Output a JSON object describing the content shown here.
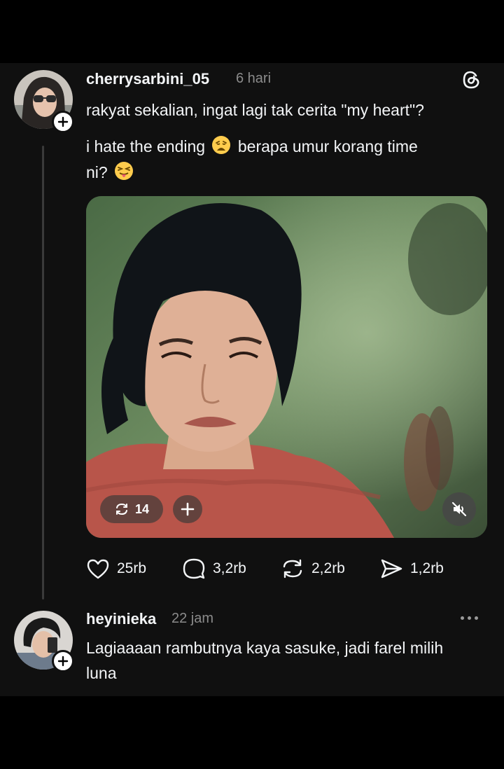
{
  "colors": {
    "background": "#000000",
    "feed_background": "#101010",
    "text": "#f3f5f7",
    "muted": "#8b8b8b",
    "thread_line": "#3a3a3a"
  },
  "post": {
    "username": "cherrysarbini_05",
    "time": "6 hari",
    "text_line1": "rakyat sekalian, ingat lagi tak cerita \"my heart\"?",
    "text_line2a": "i hate the ending",
    "emoji_1": "weary-face-emoji",
    "text_line2b": "berapa umur korang time",
    "text_line3": "ni?",
    "emoji_2": "squinting-tongue-face-emoji",
    "media": {
      "repost_count": "14",
      "repost_icon": "repost-icon",
      "add_icon": "plus-icon",
      "mute_icon": "muted-speaker-icon"
    },
    "actions": {
      "likes": "25rb",
      "comments": "3,2rb",
      "reposts": "2,2rb",
      "shares": "1,2rb"
    }
  },
  "reply": {
    "username": "heyinieka",
    "time": "22 jam",
    "text_line1": "Lagiaaaan rambutnya kaya sasuke, jadi farel milih",
    "text_line2": "luna",
    "more_icon": "more-dots-icon"
  }
}
